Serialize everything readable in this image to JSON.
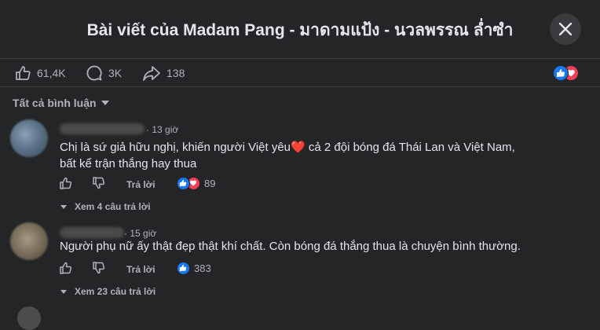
{
  "dialog": {
    "title": "Bài viết của Madam Pang - มาดามแป้ง - นวลพรรณ ล่ำซำ"
  },
  "stats": {
    "likes": "61,4K",
    "comments": "3K",
    "shares": "138"
  },
  "colors": {
    "bg": "#242526",
    "text": "#e4e6eb",
    "secondary": "#b0b3b8",
    "like_blue": "#1877f2",
    "love_red": "#f33e58"
  },
  "filter": {
    "label": "Tất cả bình luận"
  },
  "comments": [
    {
      "time": "13 giờ",
      "text_line1": "Chị là sứ giả hữu nghị, khiến người Việt yêu",
      "emoji": "❤️",
      "text_line1_rest": " cả 2 đội bóng đá Thái Lan và Việt Nam,",
      "text_line2": "bất kể trận thắng hay thua",
      "reply_label": "Trả lời",
      "reaction_count": "89",
      "view_replies": "Xem 4 câu trả lời"
    },
    {
      "time": "15 giờ",
      "text_line1": "Người phụ nữ ấy thật đẹp thật khí chất. Còn bóng đá thắng thua là chuyện bình thường.",
      "reply_label": "Trả lời",
      "reaction_count": "383",
      "view_replies": "Xem 23 câu trả lời"
    }
  ]
}
